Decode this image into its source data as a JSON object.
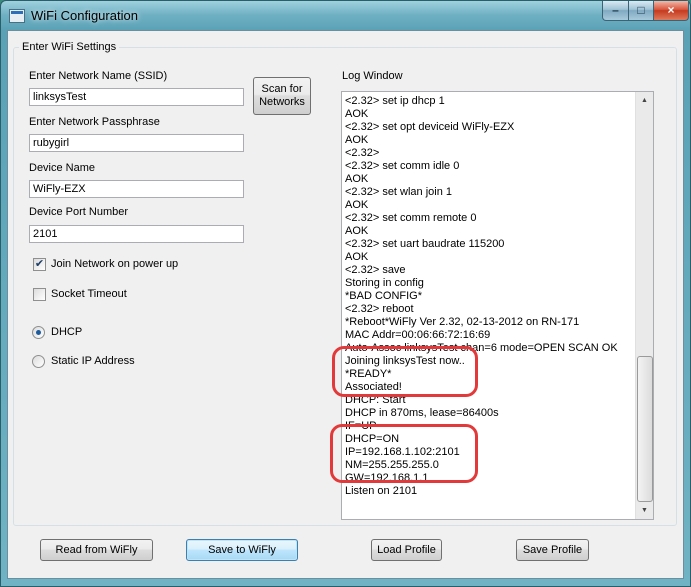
{
  "window": {
    "title": "WiFi Configuration"
  },
  "titlebar_controls": {
    "minimize": "–",
    "maximize": "□",
    "close": "×"
  },
  "group": {
    "title": "Enter WiFi Settings"
  },
  "fields": {
    "ssid": {
      "label": "Enter Network Name (SSID)",
      "value": "linksysTest"
    },
    "passphrase": {
      "label": "Enter Network Passphrase",
      "value": "rubygirl"
    },
    "device_name": {
      "label": "Device Name",
      "value": "WiFly-EZX"
    },
    "device_port": {
      "label": "Device Port Number",
      "value": "2101"
    }
  },
  "scan_button": {
    "line1": "Scan for",
    "line2": "Networks"
  },
  "options": {
    "join_on_power_up": {
      "label": "Join Network on power up",
      "checked": true,
      "mark": "✔"
    },
    "socket_timeout": {
      "label": "Socket Timeout",
      "checked": false
    }
  },
  "ip_mode": {
    "dhcp": {
      "label": "DHCP",
      "selected": true
    },
    "static": {
      "label": "Static IP Address",
      "selected": false
    }
  },
  "log": {
    "label": "Log Window",
    "lines": [
      "<2.32> set ip dhcp 1",
      "AOK",
      "<2.32> set opt deviceid WiFly-EZX",
      "AOK",
      "<2.32>",
      "<2.32> set comm idle 0",
      "AOK",
      "<2.32> set wlan join 1",
      "AOK",
      "<2.32> set comm remote 0",
      "AOK",
      "<2.32> set uart baudrate 115200",
      "AOK",
      "<2.32> save",
      "Storing in config",
      "*BAD CONFIG*",
      "<2.32> reboot",
      "*Reboot*WiFly Ver 2.32, 02-13-2012 on RN-171",
      "MAC Addr=00:06:66:72:16:69",
      "Auto-Assoc linksysTest chan=6 mode=OPEN SCAN OK",
      "Joining linksysTest now..",
      "*READY*",
      "Associated!",
      "DHCP: Start",
      "DHCP in 870ms, lease=86400s",
      "IF=UP",
      "DHCP=ON",
      "IP=192.168.1.102:2101",
      "NM=255.255.255.0",
      "GW=192.168.1.1",
      "Listen on 2101"
    ]
  },
  "scroll_arrows": {
    "up": "▲",
    "down": "▼"
  },
  "buttons": {
    "read": "Read from WiFly",
    "save": "Save to WiFly",
    "load_profile": "Load Profile",
    "save_profile": "Save Profile"
  },
  "colors": {
    "highlight": "#e23a3a",
    "selected_radio": "#1e5b9c"
  }
}
